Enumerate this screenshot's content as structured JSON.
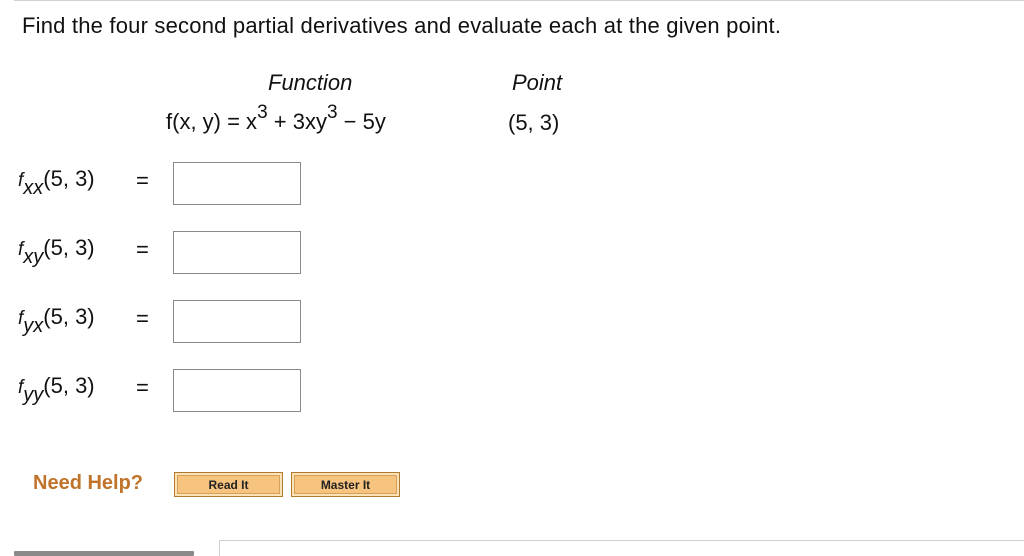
{
  "question": {
    "instruction": "Find the four second partial derivatives and evaluate each at the given point.",
    "function_header": "Function",
    "point_header": "Point",
    "function": {
      "prefix": "f(x, y) = x",
      "exp1": "3",
      "mid": " + 3xy",
      "exp2": "3",
      "suffix": " − 5y"
    },
    "point": "(5, 3)"
  },
  "answers": [
    {
      "f": "f",
      "sub": "xx",
      "args": "(5, 3)",
      "eq": "=",
      "value": ""
    },
    {
      "f": "f",
      "sub": "xy",
      "args": "(5, 3)",
      "eq": "=",
      "value": ""
    },
    {
      "f": "f",
      "sub": "yx",
      "args": "(5, 3)",
      "eq": "=",
      "value": ""
    },
    {
      "f": "f",
      "sub": "yy",
      "args": "(5, 3)",
      "eq": "=",
      "value": ""
    }
  ],
  "help": {
    "label": "Need Help?",
    "read_it": "Read It",
    "master_it": "Master It"
  },
  "colors": {
    "help_text": "#c0732a",
    "button_fill": "#f7c480",
    "input_border": "#8a8a8a"
  }
}
